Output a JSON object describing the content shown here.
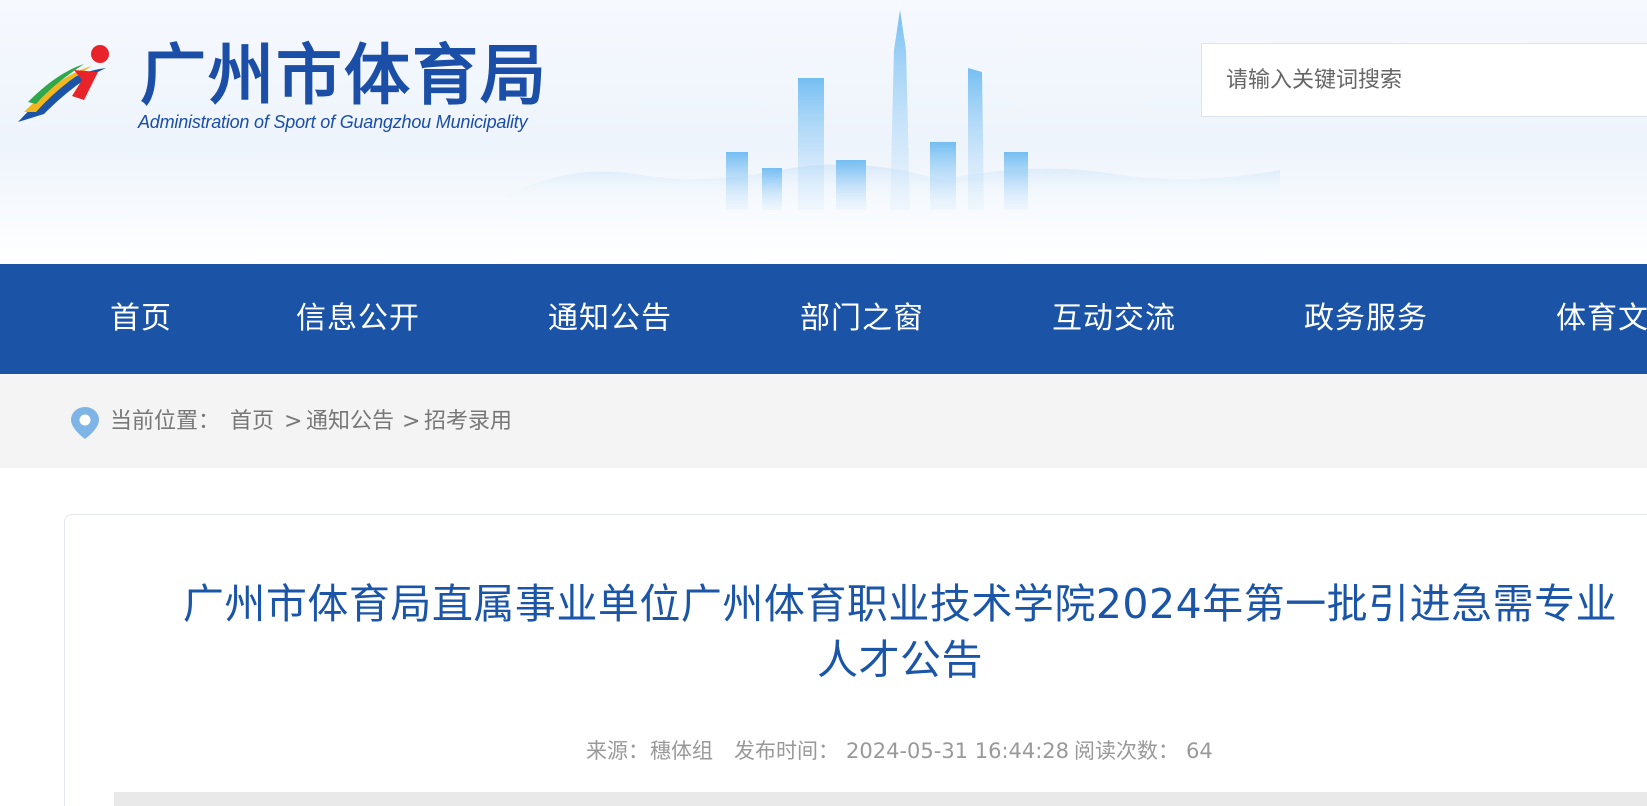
{
  "header": {
    "site_title": "广州市体育局",
    "site_subtitle": "Administration of Sport of Guangzhou Municipality",
    "logo_icon": "runner-logo-icon",
    "search_placeholder": "请输入关键词搜索"
  },
  "nav": {
    "items": [
      {
        "label": "首页"
      },
      {
        "label": "信息公开"
      },
      {
        "label": "通知公告"
      },
      {
        "label": "部门之窗"
      },
      {
        "label": "互动交流"
      },
      {
        "label": "政务服务"
      },
      {
        "label": "体育文"
      }
    ]
  },
  "breadcrumb": {
    "icon": "location-pin-icon",
    "prefix": "当前位置：",
    "items": [
      "首页",
      "通知公告",
      "招考录用"
    ],
    "separator": ">"
  },
  "article": {
    "title_line1": "广州市体育局直属事业单位广州体育职业技术学院2024年第一批引进急需专业",
    "title_line2": "人才公告",
    "source_label": "来源：",
    "source_value": "穗体组",
    "published_label": "发布时间：",
    "published_value": "2024-05-31 16:44:28",
    "views_label": "阅读次数：",
    "views_value": "64"
  },
  "colors": {
    "brand_blue": "#1b54a6",
    "title_blue": "#1b55a7",
    "crumb_bg": "#f4f4f4"
  }
}
